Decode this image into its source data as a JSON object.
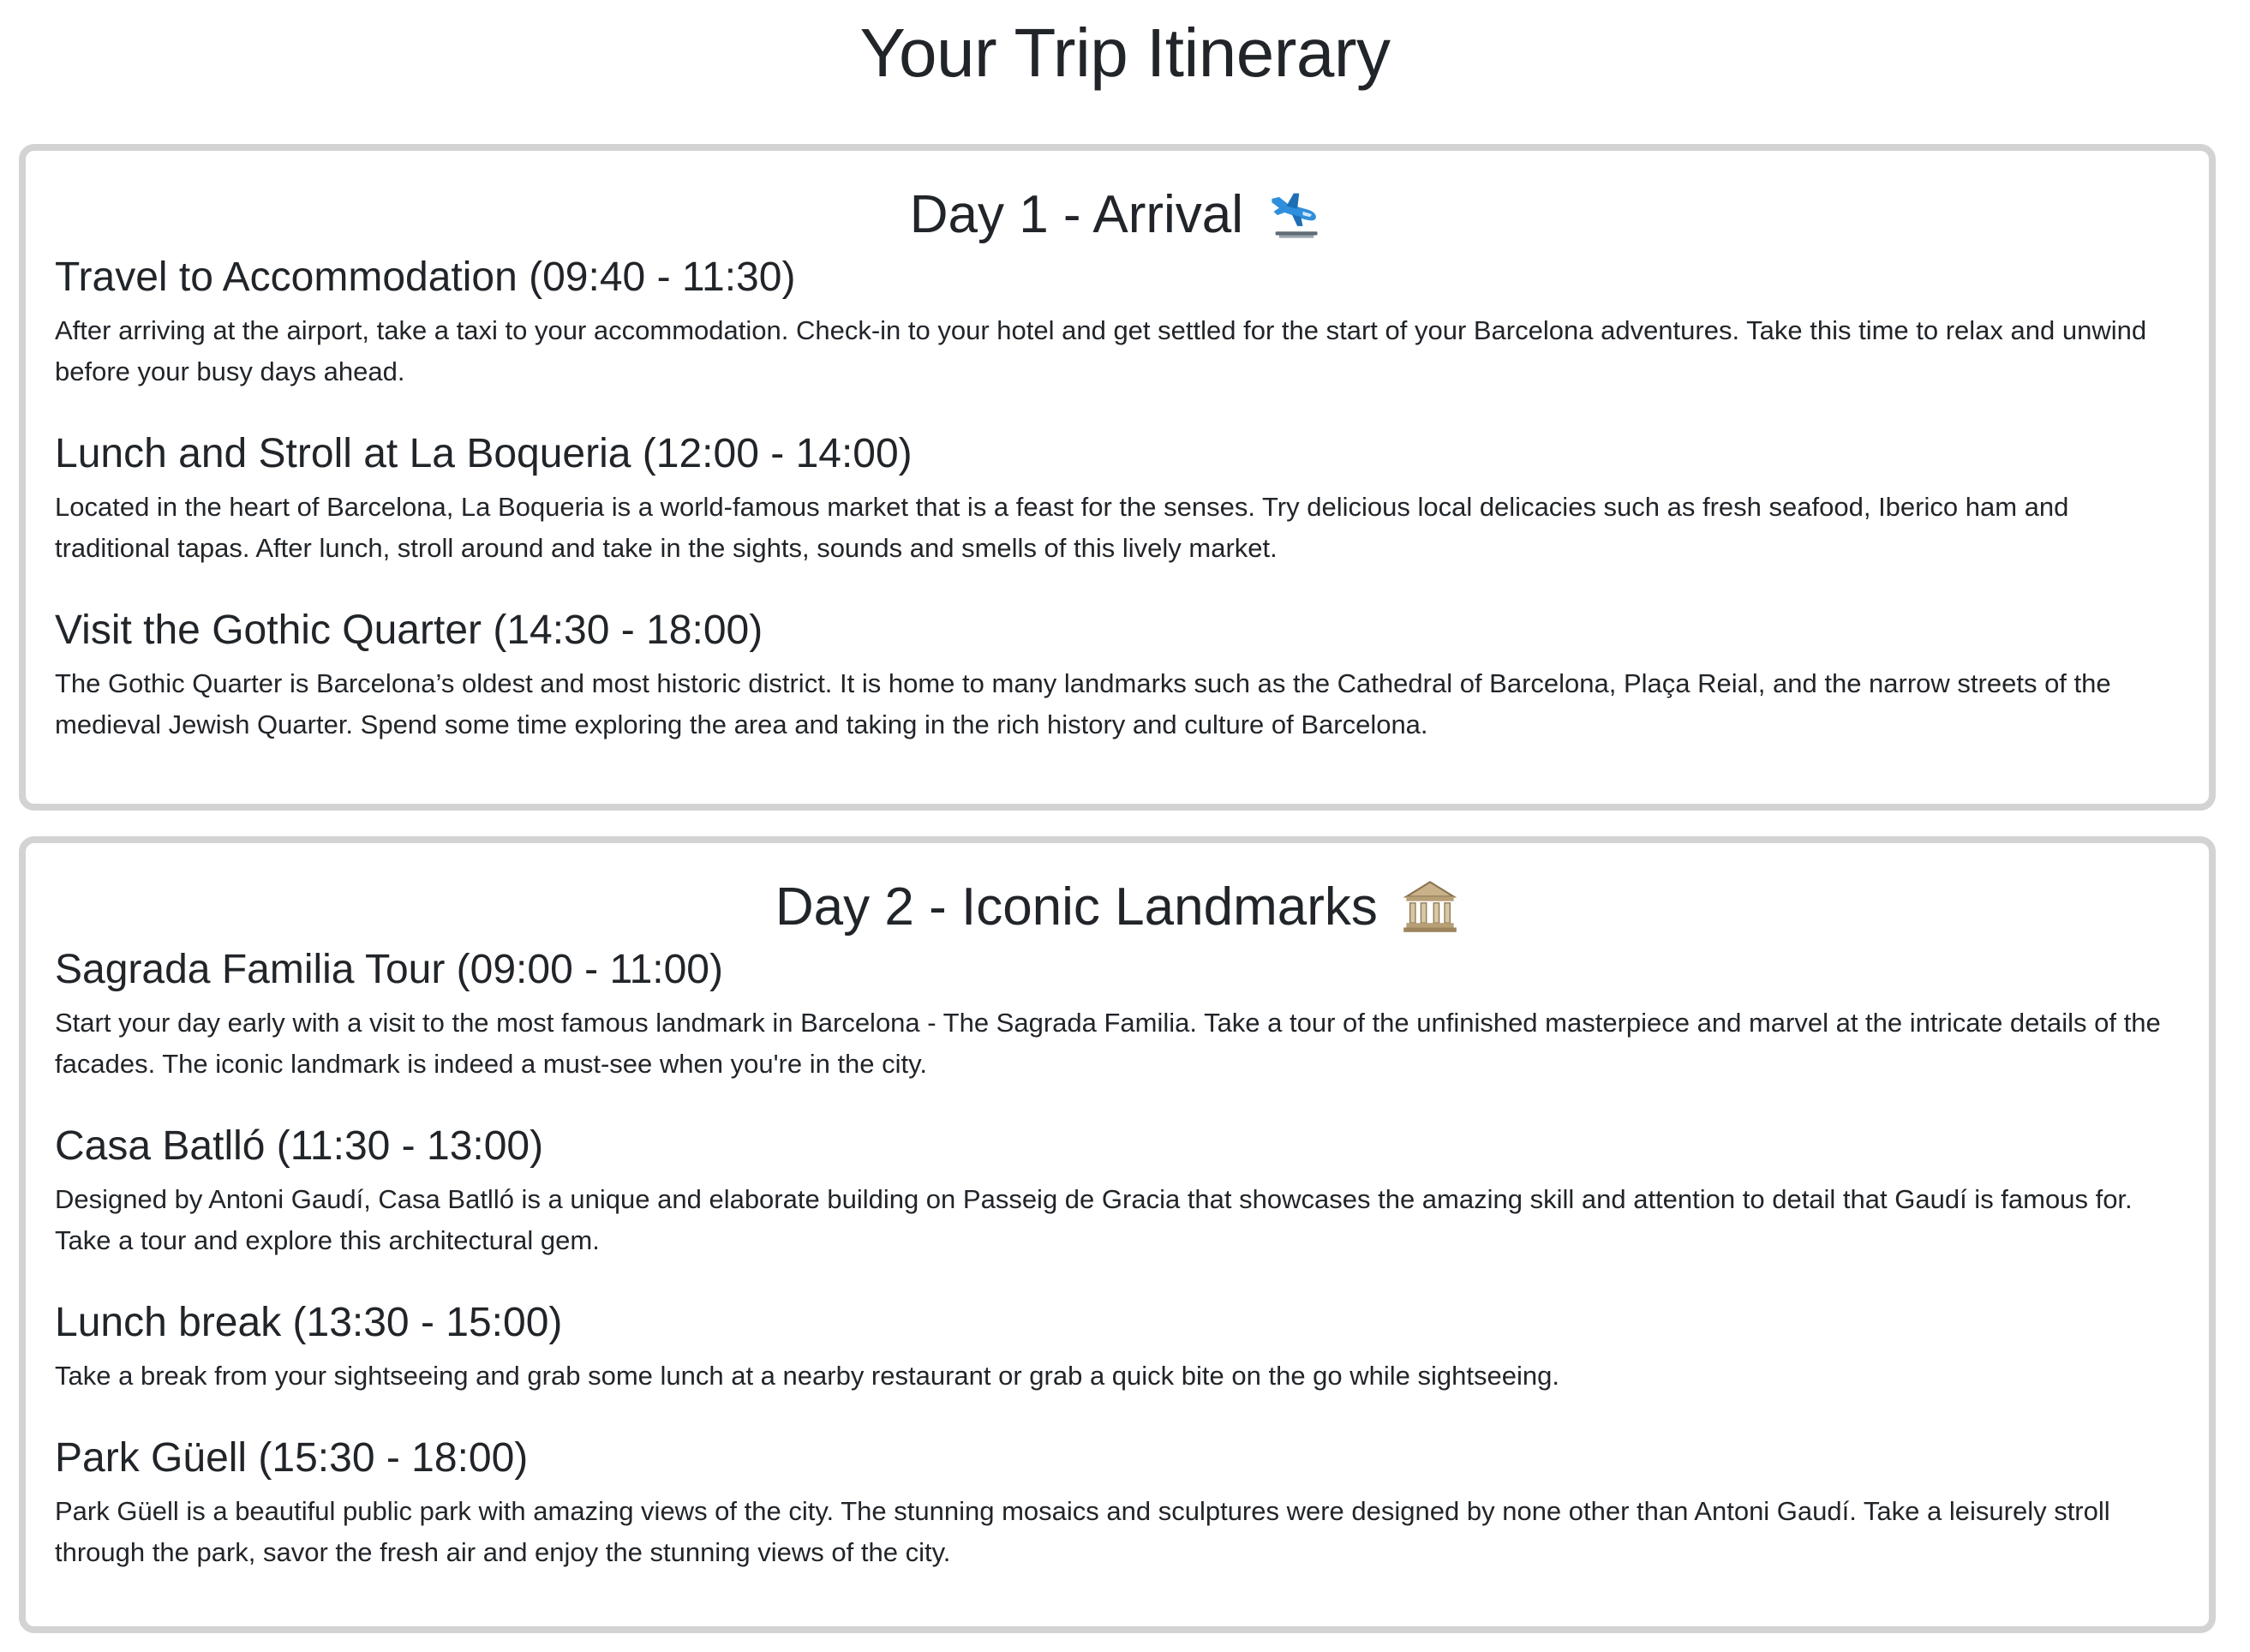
{
  "page": {
    "title": "Your Trip Itinerary"
  },
  "days": [
    {
      "heading": "Day 1 - Arrival",
      "emoji": "airplane-arrival-icon",
      "activities": [
        {
          "title": "Travel to Accommodation (09:40 - 11:30)",
          "description": "After arriving at the airport, take a taxi to your accommodation. Check-in to your hotel and get settled for the start of your Barcelona adventures. Take this time to relax and unwind before your busy days ahead."
        },
        {
          "title": "Lunch and Stroll at La Boqueria (12:00 - 14:00)",
          "description": "Located in the heart of Barcelona, La Boqueria is a world-famous market that is a feast for the senses. Try delicious local delicacies such as fresh seafood, Iberico ham and traditional tapas. After lunch, stroll around and take in the sights, sounds and smells of this lively market."
        },
        {
          "title": "Visit the Gothic Quarter (14:30 - 18:00)",
          "description": "The Gothic Quarter is Barcelona’s oldest and most historic district. It is home to many landmarks such as the Cathedral of Barcelona, Plaça Reial, and the narrow streets of the medieval Jewish Quarter. Spend some time exploring the area and taking in the rich history and culture of Barcelona."
        }
      ]
    },
    {
      "heading": "Day 2 - Iconic Landmarks",
      "emoji": "classical-building-icon",
      "activities": [
        {
          "title": "Sagrada Familia Tour (09:00 - 11:00)",
          "description": "Start your day early with a visit to the most famous landmark in Barcelona - The Sagrada Familia. Take a tour of the unfinished masterpiece and marvel at the intricate details of the facades. The iconic landmark is indeed a must-see when you're in the city."
        },
        {
          "title": "Casa Batlló (11:30 - 13:00)",
          "description": "Designed by Antoni Gaudí, Casa Batlló is a unique and elaborate building on Passeig de Gracia that showcases the amazing skill and attention to detail that Gaudí is famous for. Take a tour and explore this architectural gem."
        },
        {
          "title": "Lunch break (13:30 - 15:00)",
          "description": "Take a break from your sightseeing and grab some lunch at a nearby restaurant or grab a quick bite on the go while sightseeing."
        },
        {
          "title": "Park Güell (15:30 - 18:00)",
          "description": "Park Güell is a beautiful public park with amazing views of the city. The stunning mosaics and sculptures were designed by none other than Antoni Gaudí. Take a leisurely stroll through the park, savor the fresh air and enjoy the stunning views of the city."
        }
      ]
    }
  ]
}
